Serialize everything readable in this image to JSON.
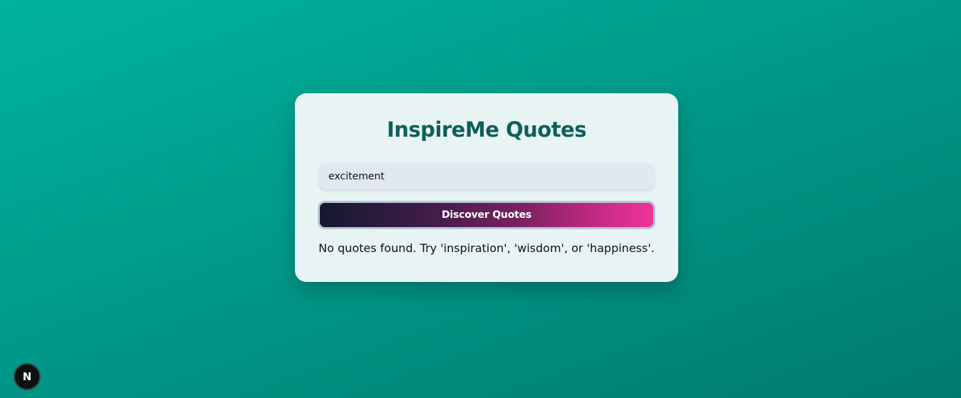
{
  "app": {
    "title": "InspireMe Quotes"
  },
  "search": {
    "value": "excitement",
    "placeholder": ""
  },
  "actions": {
    "discover_label": "Discover Quotes"
  },
  "results": {
    "message": "No quotes found. Try 'inspiration', 'wisdom', or 'happiness'."
  },
  "dev_badge": {
    "letter": "N",
    "icon": "nextjs-logo-icon"
  },
  "colors": {
    "background_from": "#00b39f",
    "background_to": "#007a6d",
    "card": "#e8f4f3",
    "title": "#0f5f5a",
    "button_from": "#131a2e",
    "button_to": "#f1339a"
  }
}
